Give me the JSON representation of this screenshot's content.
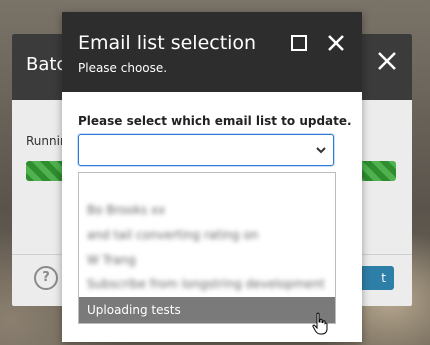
{
  "background_dialog": {
    "title": "Batc",
    "running_label": "Runnin",
    "help_icon": "?",
    "button_label": "t",
    "progress_percent": 100,
    "colors": {
      "header": "#3b3b3b",
      "progress": "#3a9a3a",
      "button": "#2e7fa8"
    }
  },
  "dialog": {
    "title": "Email list selection",
    "subtitle": "Please choose.",
    "icons": [
      "maximize-icon",
      "close-icon"
    ],
    "prompt": "Please select which email list to update.",
    "select": {
      "value": ""
    },
    "dropdown": {
      "blurred_options": [
        "Bo Brooks xx",
        "and tail converting rating on",
        "W Trang",
        "Subscribe from longstring development"
      ],
      "highlighted_option": "Uploading tests"
    },
    "colors": {
      "header": "#2d2d2d",
      "focus": "#2b7bd6",
      "highlight": "#7a7a7a"
    }
  }
}
